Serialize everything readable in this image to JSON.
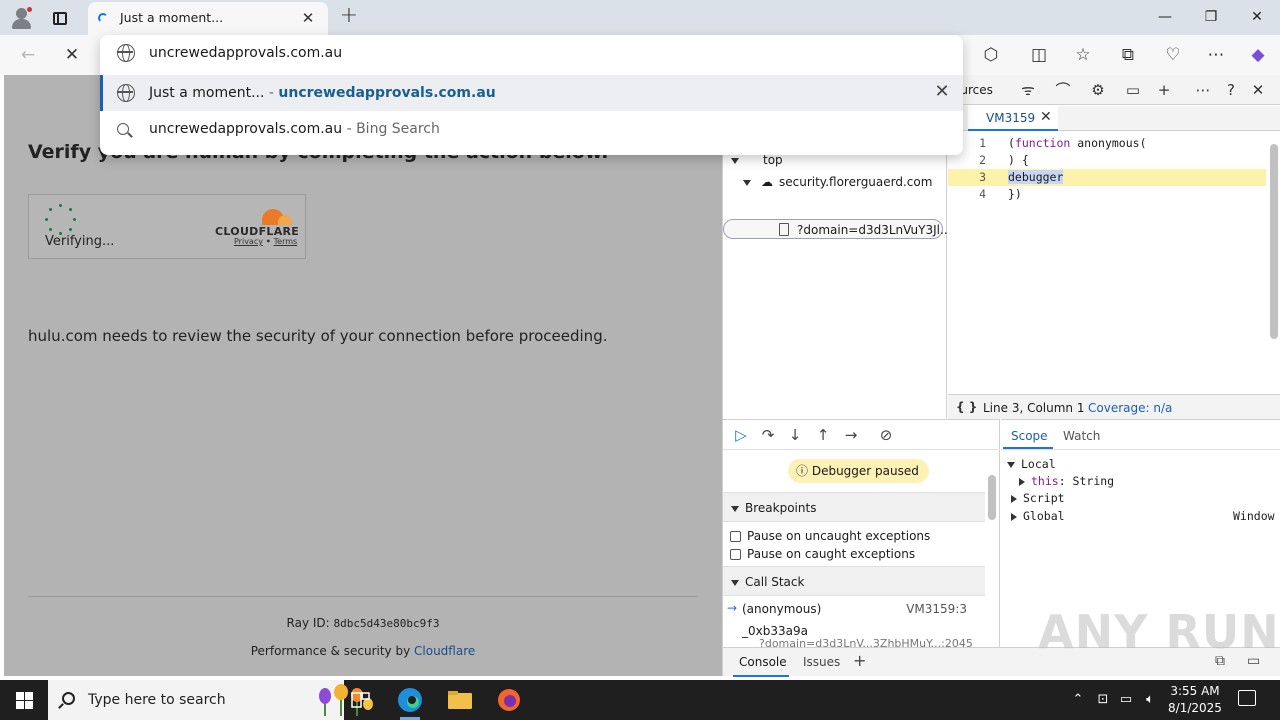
{
  "browser": {
    "tab_title": "Just a moment...",
    "omnibox": {
      "typed": "uncrewedapprovals.com.au",
      "suggestion_title": "Just a moment...",
      "suggestion_sep": " - ",
      "suggestion_url": "uncrewedapprovals.com.au",
      "search_query": "uncrewedapprovals.com.au",
      "search_suffix": " - Bing Search"
    }
  },
  "page": {
    "heading": "Verify you are human by completing the action below.",
    "verifying": "Verifying...",
    "cloudflare_brand": "CLOUDFLARE",
    "privacy": "Privacy",
    "links_sep": " • ",
    "terms": "Terms",
    "security_message": "hulu.com needs to review the security of your connection before proceeding.",
    "ray_label": "Ray ID: ",
    "ray_id": "8dbc5d43e80bc9f3",
    "perf_label": "Performance & security by ",
    "perf_link": "Cloudflare"
  },
  "devtools": {
    "panel_tab": "ources",
    "navigator": {
      "top": "top",
      "domain": "security.florerguaerd.com",
      "file": "?domain=d3d3LnVuY3Jl..."
    },
    "editor": {
      "tab": "VM3159",
      "lines": [
        {
          "n": "1",
          "pre": "(",
          "kw": "function",
          "post": " anonymous("
        },
        {
          "n": "2",
          "pre": ") {",
          "kw": "",
          "post": ""
        },
        {
          "n": "3",
          "pre": "",
          "kw": "",
          "post": "debugger"
        },
        {
          "n": "4",
          "pre": "})",
          "kw": "",
          "post": ""
        }
      ],
      "braces": "{ }",
      "position": "Line 3, Column 1",
      "coverage": "Coverage: n/a"
    },
    "debugger": {
      "paused": "Debugger paused",
      "breakpoints": "Breakpoints",
      "pause_uncaught": "Pause on uncaught exceptions",
      "pause_caught": "Pause on caught exceptions",
      "call_stack": "Call Stack",
      "frames": [
        {
          "fn": "(anonymous)",
          "loc": "VM3159:3"
        },
        {
          "fn": "_0xb33a9a",
          "loc": ""
        }
      ],
      "frame2_sub": "?domain=d3d3LnV...3ZhbHMuY...:2045"
    },
    "scope": {
      "tab_scope": "Scope",
      "tab_watch": "Watch",
      "local": "Local",
      "this_key": "this",
      "this_val": ": String",
      "script": "Script",
      "global": "Global",
      "global_val": "Window"
    },
    "drawer": {
      "console": "Console",
      "issues": "Issues"
    }
  },
  "watermark": "ANY RUN",
  "taskbar": {
    "search_placeholder": "Type here to search",
    "time": "3:55 AM",
    "date": "8/1/2025"
  }
}
